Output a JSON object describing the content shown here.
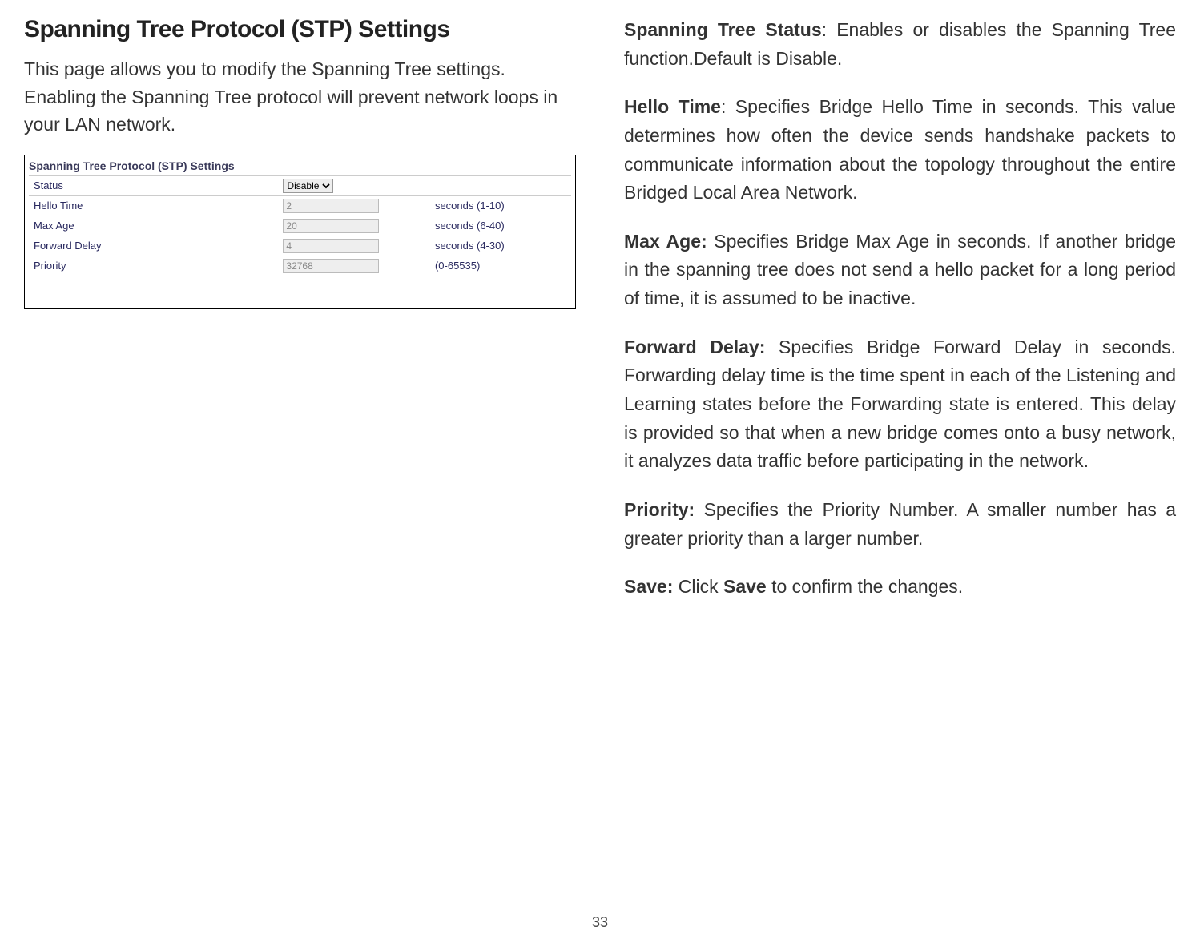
{
  "left": {
    "heading": "Spanning Tree Protocol (STP) Settings",
    "intro": "This page allows you to modify the Spanning Tree settings. Enabling the Spanning Tree protocol will prevent network loops in your LAN network.",
    "settings": {
      "title": "Spanning Tree Protocol (STP) Settings",
      "rows": {
        "status": {
          "label": "Status",
          "value": "Disable",
          "hint": ""
        },
        "helloTime": {
          "label": "Hello Time",
          "value": "2",
          "hint": "seconds (1-10)"
        },
        "maxAge": {
          "label": "Max Age",
          "value": "20",
          "hint": "seconds (6-40)"
        },
        "forwardDelay": {
          "label": "Forward Delay",
          "value": "4",
          "hint": "seconds (4-30)"
        },
        "priority": {
          "label": "Priority",
          "value": "32768",
          "hint": "(0-65535)"
        }
      }
    }
  },
  "right": {
    "defs": {
      "spanningTreeStatus": {
        "term": "Spanning Tree Status",
        "sep": ": ",
        "text": "Enables or disables the Spanning Tree function.Default is Disable."
      },
      "helloTime": {
        "term": "Hello Time",
        "sep": ": ",
        "text": "Specifies Bridge Hello Time in seconds. This value determines how often the device sends handshake packets to communicate information about the topology throughout the entire Bridged Local Area Network."
      },
      "maxAge": {
        "term": "Max Age:",
        "sep": " ",
        "text": "Specifies Bridge Max Age in seconds. If another bridge in the spanning tree does not send a hello packet for a long period of time, it is assumed to be inactive."
      },
      "forwardDelay": {
        "term": "Forward Delay:",
        "sep": " ",
        "text": "Specifies Bridge Forward Delay in seconds. Forwarding delay time is the time spent in each of the Listening and Learning states before the Forwarding state is entered. This delay is provided so that when a new bridge comes onto a busy network, it analyzes data traffic before participating in the network."
      },
      "priority": {
        "term": "Priority:",
        "sep": " ",
        "text": "Specifies the Priority Number. A smaller number has a greater priority than a larger number."
      },
      "save": {
        "term": "Save:",
        "sep": " ",
        "pre": "Click ",
        "bold": "Save",
        "post": " to confirm the changes."
      }
    }
  },
  "pageNumber": "33"
}
